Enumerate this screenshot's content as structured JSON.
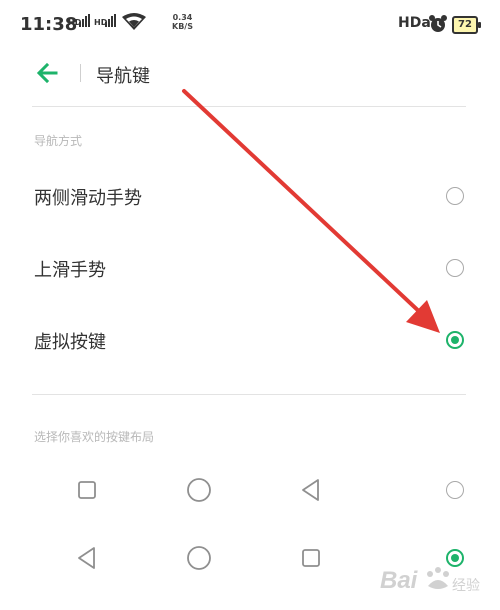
{
  "status_bar": {
    "time": "11:38",
    "network_speed_value": "0.34",
    "network_speed_unit": "KB/S",
    "hd_label": "HDa",
    "battery_level": "72",
    "icons": [
      "signal-icon",
      "signal-icon",
      "wifi-icon",
      "alarm-icon",
      "battery-icon"
    ]
  },
  "header": {
    "back_icon": "arrow-left-icon",
    "title": "导航键"
  },
  "nav_mode": {
    "section_label": "导航方式",
    "options": [
      {
        "label": "两侧滑动手势",
        "selected": false
      },
      {
        "label": "上滑手势",
        "selected": false
      },
      {
        "label": "虚拟按键",
        "selected": true
      }
    ]
  },
  "layout": {
    "section_label": "选择你喜欢的按键布局",
    "rows": [
      {
        "icons": [
          "square-icon",
          "circle-icon",
          "triangle-left-icon"
        ],
        "selected": false
      },
      {
        "icons": [
          "triangle-left-icon",
          "circle-icon",
          "square-icon"
        ],
        "selected": true
      }
    ]
  },
  "watermark": {
    "text": "Bai经验"
  },
  "colors": {
    "accent": "#1db36a",
    "annotation_arrow": "#e23a34"
  }
}
